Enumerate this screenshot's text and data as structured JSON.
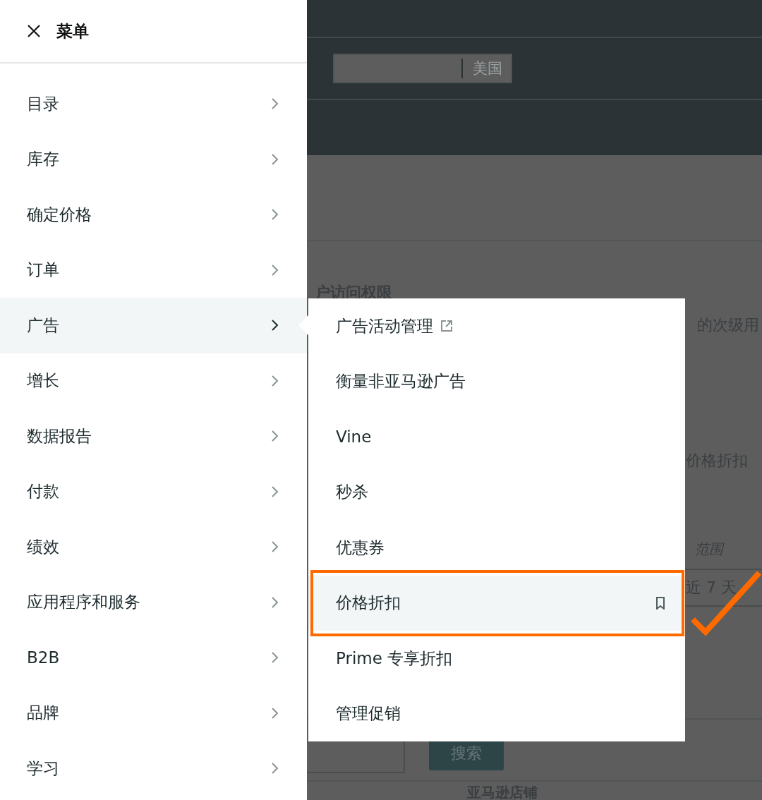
{
  "page": {
    "region_selector": "美国",
    "section_title": "户访问权限",
    "description_1": "的次级用",
    "description_2": "价格折扣",
    "date_range_label": "范围",
    "date_range_value": "近 7 天",
    "search_button": "搜索",
    "store_heading": "亚马逊店铺"
  },
  "menu": {
    "title": "菜单",
    "items": [
      {
        "label": "目录",
        "selected": false
      },
      {
        "label": "库存",
        "selected": false
      },
      {
        "label": "确定价格",
        "selected": false
      },
      {
        "label": "订单",
        "selected": false
      },
      {
        "label": "广告",
        "selected": true
      },
      {
        "label": "增长",
        "selected": false
      },
      {
        "label": "数据报告",
        "selected": false
      },
      {
        "label": "付款",
        "selected": false
      },
      {
        "label": "绩效",
        "selected": false
      },
      {
        "label": "应用程序和服务",
        "selected": false
      },
      {
        "label": "B2B",
        "selected": false
      },
      {
        "label": "品牌",
        "selected": false
      },
      {
        "label": "学习",
        "selected": false
      }
    ]
  },
  "submenu": {
    "items": [
      {
        "label": "广告活动管理",
        "kind": "link",
        "selected": false,
        "outlined": false
      },
      {
        "label": "衡量非亚马逊广告",
        "kind": "plain",
        "selected": false,
        "outlined": false
      },
      {
        "label": "Vine",
        "kind": "plain",
        "selected": false,
        "outlined": false
      },
      {
        "label": "秒杀",
        "kind": "plain",
        "selected": false,
        "outlined": false
      },
      {
        "label": "优惠券",
        "kind": "plain",
        "selected": false,
        "outlined": false
      },
      {
        "label": "价格折扣",
        "kind": "pinned",
        "selected": true,
        "outlined": true
      },
      {
        "label": "Prime 专享折扣",
        "kind": "plain",
        "selected": false,
        "outlined": false
      },
      {
        "label": "管理促销",
        "kind": "plain",
        "selected": false,
        "outlined": false
      }
    ]
  },
  "check_mark": true
}
